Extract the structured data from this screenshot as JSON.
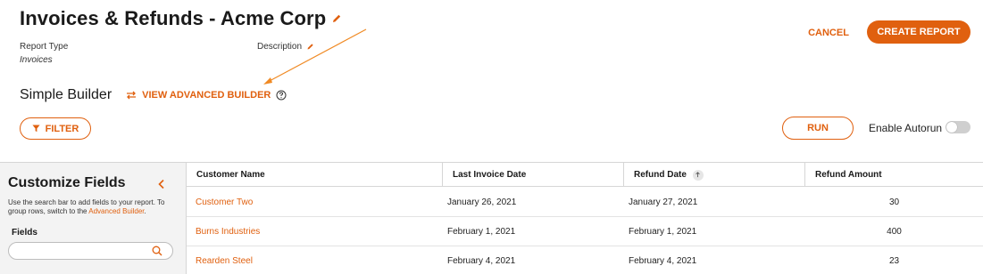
{
  "header": {
    "title": "Invoices & Refunds - Acme Corp",
    "report_type_label": "Report Type",
    "report_type_value": "Invoices",
    "description_label": "Description",
    "cancel_label": "CANCEL",
    "create_label": "CREATE REPORT"
  },
  "builder": {
    "title": "Simple Builder",
    "advanced_link": "VIEW ADVANCED BUILDER",
    "filter_label": "FILTER",
    "run_label": "RUN",
    "autorun_label": "Enable Autorun",
    "autorun_enabled": false
  },
  "sidebar": {
    "title": "Customize Fields",
    "help_text": "Use the search bar to add fields to your report. To group rows, switch to the ",
    "help_link": "Advanced Builder",
    "help_end": ".",
    "fields_label": "Fields",
    "search_value": ""
  },
  "table": {
    "columns": [
      "Customer Name",
      "Last Invoice Date",
      "Refund Date",
      "Refund Amount"
    ],
    "rows": [
      [
        "Customer Two",
        "January 26, 2021",
        "January 27, 2021",
        "30"
      ],
      [
        "Burns Industries",
        "February 1, 2021",
        "February 1, 2021",
        "400"
      ],
      [
        "Rearden Steel",
        "February 4, 2021",
        "February 4, 2021",
        "23"
      ]
    ]
  },
  "colors": {
    "accent": "#e0600f",
    "sidebar_bg": "#f3f3f3",
    "divider": "#d6d6d6"
  },
  "icons": [
    "pencil-icon",
    "swap-icon",
    "help-icon",
    "filter-icon",
    "chevron-left-icon",
    "search-icon",
    "sort-up-icon"
  ]
}
